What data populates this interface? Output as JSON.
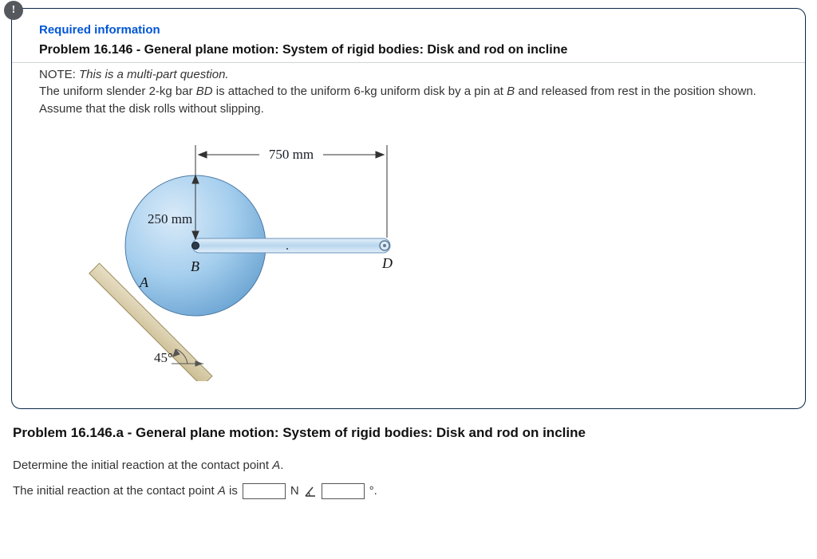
{
  "card": {
    "alert_glyph": "!",
    "required_label": "Required information",
    "title": "Problem 16.146 - General plane motion: System of rigid bodies: Disk and rod on incline",
    "note_label": "NOTE: ",
    "note_text": "This is a multi-part question.",
    "body_1": "The uniform slender 2-kg bar ",
    "body_bd": "BD",
    "body_2": " is attached to the uniform 6-kg uniform disk by a pin at ",
    "body_b": "B",
    "body_3": " and released from rest in the position shown. Assume that the disk rolls without slipping."
  },
  "figure": {
    "dim_top": "750 mm",
    "dim_radius": "250 mm",
    "label_A": "A",
    "label_B": "B",
    "label_D": "D",
    "angle": "45°"
  },
  "sub": {
    "title": "Problem 16.146.a - General plane motion: System of rigid bodies: Disk and rod on incline",
    "prompt_1": "Determine the initial reaction at the contact point ",
    "prompt_A": "A",
    "prompt_2": ".",
    "ans_1": "The initial reaction at the contact point ",
    "ans_A": "A",
    "ans_2": " is",
    "unit_N": "N",
    "deg_symbol": "°."
  }
}
